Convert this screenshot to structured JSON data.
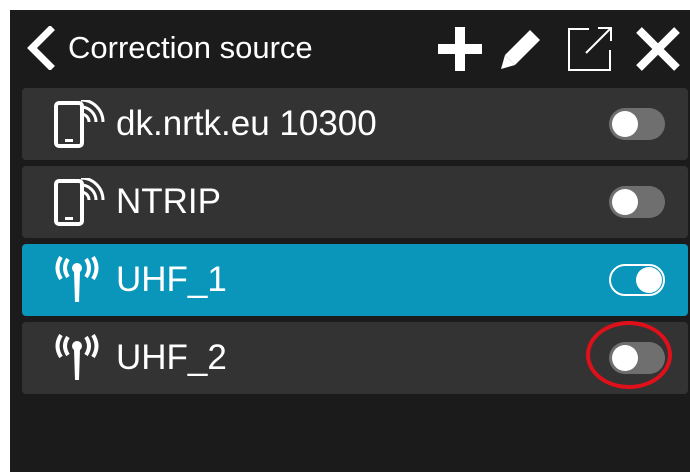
{
  "header": {
    "title": "Correction source",
    "icons": [
      "chevron-left-icon",
      "plus-icon",
      "pencil-icon",
      "external-link-icon",
      "close-icon"
    ]
  },
  "sources": [
    {
      "label": "dk.nrtk.eu 10300",
      "icon": "phone-signal-icon",
      "enabled": false,
      "selected": false
    },
    {
      "label": "NTRIP",
      "icon": "phone-signal-icon",
      "enabled": false,
      "selected": false
    },
    {
      "label": "UHF_1",
      "icon": "radio-antenna-icon",
      "enabled": true,
      "selected": true
    },
    {
      "label": "UHF_2",
      "icon": "radio-antenna-icon",
      "enabled": false,
      "selected": false
    }
  ],
  "colors": {
    "background": "#1b1b1b",
    "row": "#333333",
    "selected": "#0a96bb",
    "toggle_off": "#6f6f6f",
    "highlight": "#e0101a"
  }
}
